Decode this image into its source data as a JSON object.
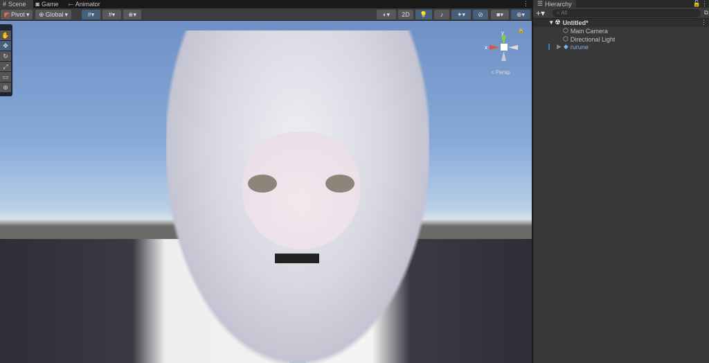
{
  "scene_tabs": [
    {
      "label": "Scene",
      "icon": "hash-icon"
    },
    {
      "label": "Game",
      "icon": "gamepad-icon"
    },
    {
      "label": "Animator",
      "icon": "animator-icon"
    }
  ],
  "toolbar": {
    "pivot": "Pivot",
    "global": "Global",
    "mode_2d": "2D"
  },
  "gizmo": {
    "x": "x",
    "y": "y",
    "projection": "Persp"
  },
  "hierarchy": {
    "title": "Hierarchy",
    "search_placeholder": "All",
    "scene": "Untitled*",
    "items": [
      {
        "label": "Main Camera"
      },
      {
        "label": "Directional Light"
      },
      {
        "label": "rurune"
      }
    ]
  },
  "colors": {
    "accent": "#46607c",
    "prefab": "#7fb3f0"
  }
}
